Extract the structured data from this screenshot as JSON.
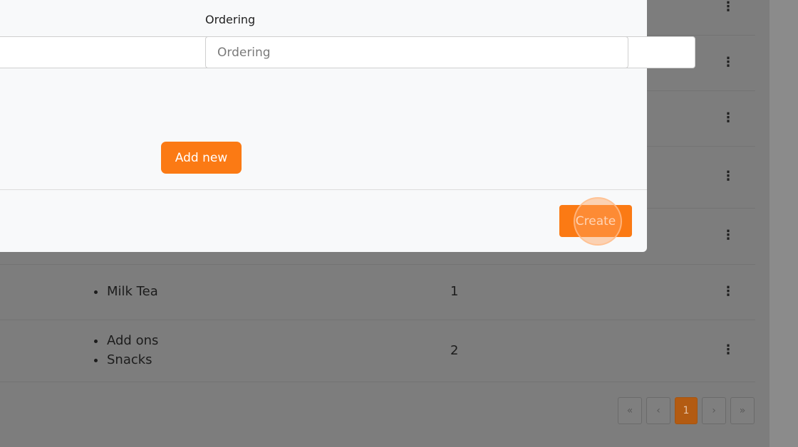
{
  "modal": {
    "ordering_label": "Ordering",
    "ordering_placeholder": "Ordering",
    "add_new_label": "Add new",
    "create_label": "Create"
  },
  "table": {
    "rows": [
      {
        "categories": [
          "Milk Tea"
        ],
        "order": "1"
      },
      {
        "categories": [
          "Add ons",
          "Snacks"
        ],
        "order": "2"
      }
    ],
    "row_menu_icon": "kebab-menu-icon"
  },
  "pagination": {
    "first": "«",
    "prev": "‹",
    "current": "1",
    "next": "›",
    "last": "»"
  },
  "colors": {
    "accent": "#fb7a14",
    "overlay": "#7d7d7d",
    "modal_bg": "#f8f9fa"
  }
}
